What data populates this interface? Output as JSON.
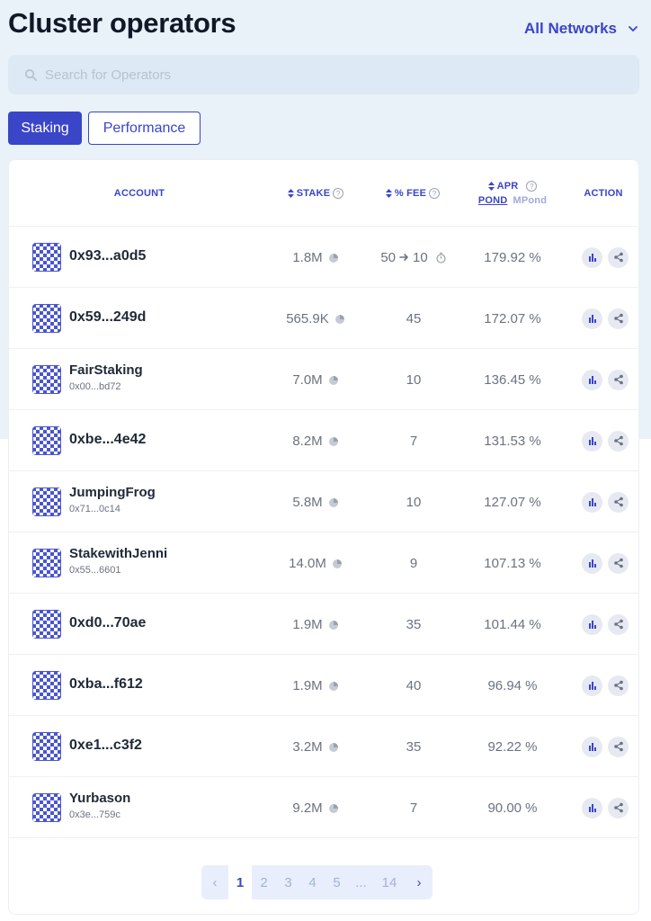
{
  "header": {
    "title": "Cluster operators",
    "network_label": "All Networks"
  },
  "search": {
    "placeholder": "Search for Operators"
  },
  "tabs": [
    {
      "label": "Staking",
      "active": true
    },
    {
      "label": "Performance",
      "active": false
    }
  ],
  "table": {
    "columns": {
      "account": "ACCOUNT",
      "stake": "STAKE",
      "fee": "% FEE",
      "apr": "APR",
      "action": "ACTION",
      "apr_pond": "POND",
      "apr_mpond": "MPond"
    },
    "rows": [
      {
        "name": "0x93...a0d5",
        "address": "",
        "stake": "1.8M",
        "fee": "50",
        "fee_new": "10",
        "apr": "179.92 %"
      },
      {
        "name": "0x59...249d",
        "address": "",
        "stake": "565.9K",
        "fee": "45",
        "fee_new": "",
        "apr": "172.07 %"
      },
      {
        "name": "FairStaking",
        "address": "0x00...bd72",
        "stake": "7.0M",
        "fee": "10",
        "fee_new": "",
        "apr": "136.45 %"
      },
      {
        "name": "0xbe...4e42",
        "address": "",
        "stake": "8.2M",
        "fee": "7",
        "fee_new": "",
        "apr": "131.53 %"
      },
      {
        "name": "JumpingFrog",
        "address": "0x71...0c14",
        "stake": "5.8M",
        "fee": "10",
        "fee_new": "",
        "apr": "127.07 %"
      },
      {
        "name": "StakewithJenni",
        "address": "0x55...6601",
        "stake": "14.0M",
        "fee": "9",
        "fee_new": "",
        "apr": "107.13 %"
      },
      {
        "name": "0xd0...70ae",
        "address": "",
        "stake": "1.9M",
        "fee": "35",
        "fee_new": "",
        "apr": "101.44 %"
      },
      {
        "name": "0xba...f612",
        "address": "",
        "stake": "1.9M",
        "fee": "40",
        "fee_new": "",
        "apr": "96.94 %"
      },
      {
        "name": "0xe1...c3f2",
        "address": "",
        "stake": "3.2M",
        "fee": "35",
        "fee_new": "",
        "apr": "92.22 %"
      },
      {
        "name": "Yurbason",
        "address": "0x3e...759c",
        "stake": "9.2M",
        "fee": "7",
        "fee_new": "",
        "apr": "90.00 %"
      }
    ]
  },
  "pagination": {
    "prev": "‹",
    "next": "›",
    "pages": [
      "1",
      "2",
      "3",
      "4",
      "5",
      "...",
      "14"
    ],
    "current": "1"
  },
  "colors": {
    "accent": "#3a45c8",
    "background_band": "#e9f1f9"
  },
  "icons": {
    "search": "search-icon",
    "dropdown": "chevron-down-icon",
    "stake": "pie-chart-icon",
    "fee_change": "arrow-right-icon",
    "fee_timer": "stopwatch-icon",
    "chart_action": "bar-chart-icon",
    "share_action": "share-icon"
  }
}
